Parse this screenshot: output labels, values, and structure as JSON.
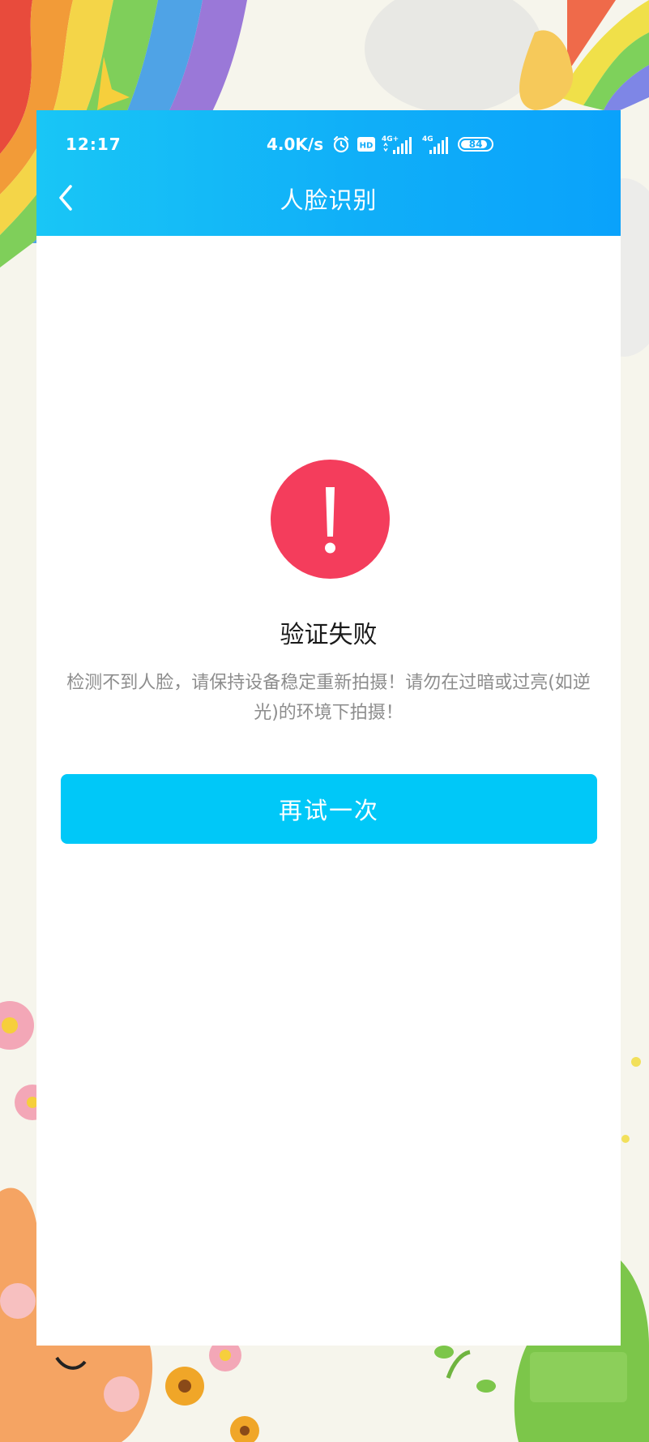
{
  "status_bar": {
    "time": "12:17",
    "net_speed": "4.0K/s",
    "hd_badge": "HD",
    "signal1_type": "4G+",
    "signal2_type": "4G",
    "battery_level": "84",
    "icons": [
      "alarm-icon",
      "hd-icon",
      "signal-icon",
      "signal-icon",
      "battery-icon"
    ]
  },
  "header": {
    "title": "人脸识别",
    "back_icon": "chevron-left-icon"
  },
  "result": {
    "icon": "exclamation-icon",
    "title": "验证失败",
    "message": "检测不到人脸，请保持设备稳定重新拍摄！请勿在过暗或过亮(如逆光)的环境下拍摄！"
  },
  "actions": {
    "retry_label": "再试一次"
  },
  "colors": {
    "header_start": "#19c6f6",
    "header_end": "#0aa2fb",
    "error_red": "#f43d5c",
    "button_blue": "#00c8f8",
    "message_gray": "#8d8d8d",
    "background": "#f6f5ec"
  }
}
